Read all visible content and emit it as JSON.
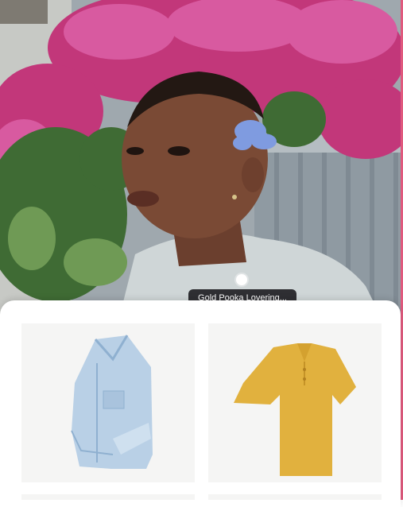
{
  "hero": {
    "image_alt": "Person with a blue flower tucked behind the ear in front of a pink bougainvillea bush",
    "hotspot": {
      "tooltip_text": "Gold Pooka Lovering..."
    }
  },
  "products": [
    {
      "name": "denim-jacket",
      "icon": "jacket-icon",
      "color": "#b9d0e6"
    },
    {
      "name": "yellow-polo",
      "icon": "polo-shirt-icon",
      "color": "#e1b13e"
    }
  ],
  "colors": {
    "accent_edge": "#e05a7e",
    "card_bg": "#f5f5f4",
    "tooltip_bg": "#2f2f33"
  }
}
